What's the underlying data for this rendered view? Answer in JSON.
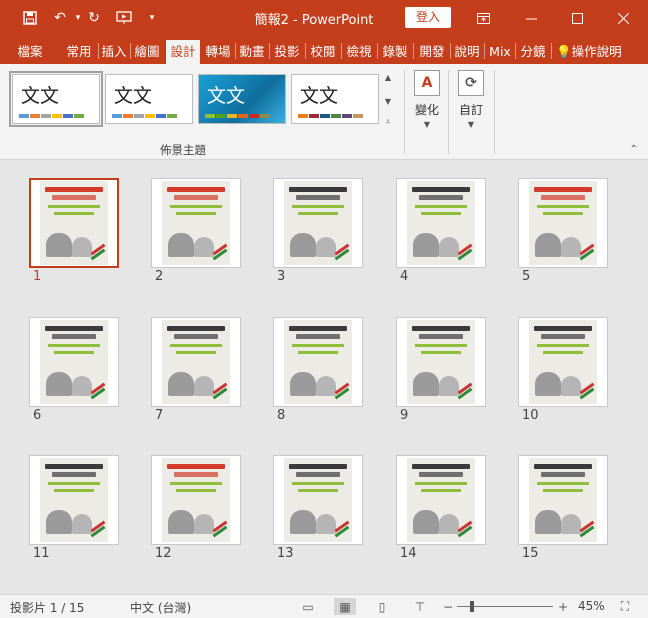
{
  "titlebar": {
    "title": "簡報2  -  PowerPoint",
    "login": "登入",
    "qat_icons": [
      "save-icon",
      "undo-icon",
      "redo-icon",
      "present-icon",
      "customize-icon"
    ],
    "window_icons": [
      "ribbon-display-icon",
      "minimize-icon",
      "maximize-icon",
      "close-icon"
    ]
  },
  "tabs": {
    "items": [
      "檔案",
      "常用",
      "插入",
      "繪圖",
      "設計",
      "轉場",
      "動畫",
      "投影",
      "校閱",
      "檢視",
      "錄製",
      "開發",
      "說明",
      "Mix",
      "分鏡"
    ],
    "active": "設計",
    "tell_me": "操作說明"
  },
  "ribbon": {
    "theme_text": "文文",
    "group_label": "佈景主題",
    "variants_label": "變化",
    "customize_label": "自訂"
  },
  "slides": {
    "numbers": [
      "1",
      "2",
      "3",
      "4",
      "5",
      "6",
      "7",
      "8",
      "9",
      "10",
      "11",
      "12",
      "13",
      "14",
      "15"
    ],
    "selected": "1"
  },
  "statusbar": {
    "slide_info": "投影片 1 / 15",
    "language": "中文 (台灣)",
    "zoom": "45%"
  },
  "colors": {
    "accent": "#c43e1c",
    "poster_bg": "#ecebe5"
  }
}
